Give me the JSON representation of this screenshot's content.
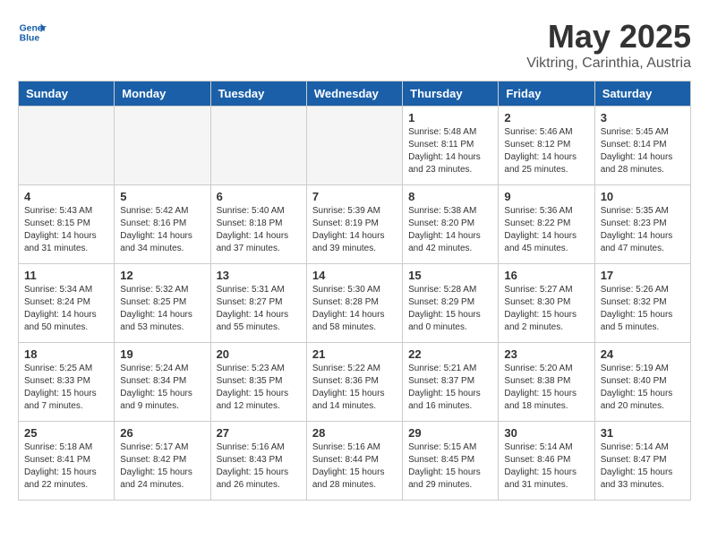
{
  "header": {
    "logo_line1": "General",
    "logo_line2": "Blue",
    "title": "May 2025",
    "subtitle": "Viktring, Carinthia, Austria"
  },
  "days_of_week": [
    "Sunday",
    "Monday",
    "Tuesday",
    "Wednesday",
    "Thursday",
    "Friday",
    "Saturday"
  ],
  "weeks": [
    [
      {
        "num": "",
        "empty": true
      },
      {
        "num": "",
        "empty": true
      },
      {
        "num": "",
        "empty": true
      },
      {
        "num": "",
        "empty": true
      },
      {
        "num": "1",
        "rise": "5:48 AM",
        "set": "8:11 PM",
        "daylight": "14 hours and 23 minutes."
      },
      {
        "num": "2",
        "rise": "5:46 AM",
        "set": "8:12 PM",
        "daylight": "14 hours and 25 minutes."
      },
      {
        "num": "3",
        "rise": "5:45 AM",
        "set": "8:14 PM",
        "daylight": "14 hours and 28 minutes."
      }
    ],
    [
      {
        "num": "4",
        "rise": "5:43 AM",
        "set": "8:15 PM",
        "daylight": "14 hours and 31 minutes."
      },
      {
        "num": "5",
        "rise": "5:42 AM",
        "set": "8:16 PM",
        "daylight": "14 hours and 34 minutes."
      },
      {
        "num": "6",
        "rise": "5:40 AM",
        "set": "8:18 PM",
        "daylight": "14 hours and 37 minutes."
      },
      {
        "num": "7",
        "rise": "5:39 AM",
        "set": "8:19 PM",
        "daylight": "14 hours and 39 minutes."
      },
      {
        "num": "8",
        "rise": "5:38 AM",
        "set": "8:20 PM",
        "daylight": "14 hours and 42 minutes."
      },
      {
        "num": "9",
        "rise": "5:36 AM",
        "set": "8:22 PM",
        "daylight": "14 hours and 45 minutes."
      },
      {
        "num": "10",
        "rise": "5:35 AM",
        "set": "8:23 PM",
        "daylight": "14 hours and 47 minutes."
      }
    ],
    [
      {
        "num": "11",
        "rise": "5:34 AM",
        "set": "8:24 PM",
        "daylight": "14 hours and 50 minutes."
      },
      {
        "num": "12",
        "rise": "5:32 AM",
        "set": "8:25 PM",
        "daylight": "14 hours and 53 minutes."
      },
      {
        "num": "13",
        "rise": "5:31 AM",
        "set": "8:27 PM",
        "daylight": "14 hours and 55 minutes."
      },
      {
        "num": "14",
        "rise": "5:30 AM",
        "set": "8:28 PM",
        "daylight": "14 hours and 58 minutes."
      },
      {
        "num": "15",
        "rise": "5:28 AM",
        "set": "8:29 PM",
        "daylight": "15 hours and 0 minutes."
      },
      {
        "num": "16",
        "rise": "5:27 AM",
        "set": "8:30 PM",
        "daylight": "15 hours and 2 minutes."
      },
      {
        "num": "17",
        "rise": "5:26 AM",
        "set": "8:32 PM",
        "daylight": "15 hours and 5 minutes."
      }
    ],
    [
      {
        "num": "18",
        "rise": "5:25 AM",
        "set": "8:33 PM",
        "daylight": "15 hours and 7 minutes."
      },
      {
        "num": "19",
        "rise": "5:24 AM",
        "set": "8:34 PM",
        "daylight": "15 hours and 9 minutes."
      },
      {
        "num": "20",
        "rise": "5:23 AM",
        "set": "8:35 PM",
        "daylight": "15 hours and 12 minutes."
      },
      {
        "num": "21",
        "rise": "5:22 AM",
        "set": "8:36 PM",
        "daylight": "15 hours and 14 minutes."
      },
      {
        "num": "22",
        "rise": "5:21 AM",
        "set": "8:37 PM",
        "daylight": "15 hours and 16 minutes."
      },
      {
        "num": "23",
        "rise": "5:20 AM",
        "set": "8:38 PM",
        "daylight": "15 hours and 18 minutes."
      },
      {
        "num": "24",
        "rise": "5:19 AM",
        "set": "8:40 PM",
        "daylight": "15 hours and 20 minutes."
      }
    ],
    [
      {
        "num": "25",
        "rise": "5:18 AM",
        "set": "8:41 PM",
        "daylight": "15 hours and 22 minutes."
      },
      {
        "num": "26",
        "rise": "5:17 AM",
        "set": "8:42 PM",
        "daylight": "15 hours and 24 minutes."
      },
      {
        "num": "27",
        "rise": "5:16 AM",
        "set": "8:43 PM",
        "daylight": "15 hours and 26 minutes."
      },
      {
        "num": "28",
        "rise": "5:16 AM",
        "set": "8:44 PM",
        "daylight": "15 hours and 28 minutes."
      },
      {
        "num": "29",
        "rise": "5:15 AM",
        "set": "8:45 PM",
        "daylight": "15 hours and 29 minutes."
      },
      {
        "num": "30",
        "rise": "5:14 AM",
        "set": "8:46 PM",
        "daylight": "15 hours and 31 minutes."
      },
      {
        "num": "31",
        "rise": "5:14 AM",
        "set": "8:47 PM",
        "daylight": "15 hours and 33 minutes."
      }
    ]
  ]
}
